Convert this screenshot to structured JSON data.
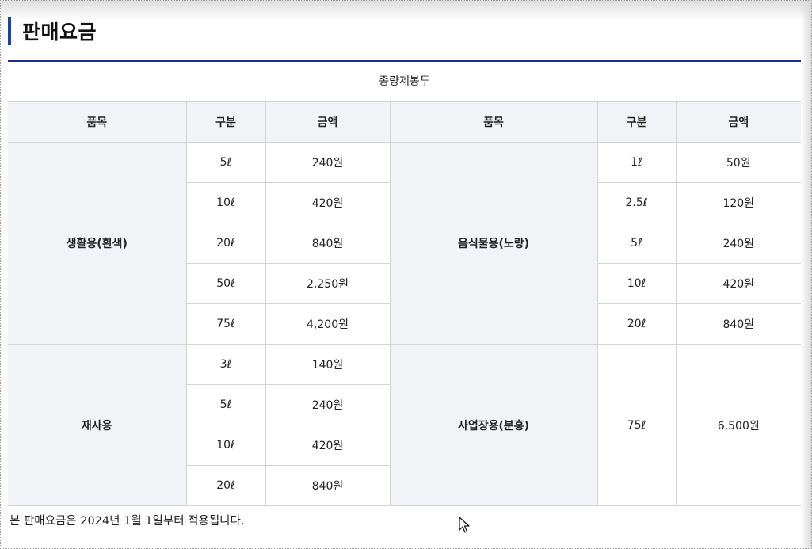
{
  "title": "판매요금",
  "table": {
    "caption": "종량제봉투",
    "headers": [
      "품목",
      "구분",
      "금액",
      "품목",
      "구분",
      "금액"
    ],
    "left": [
      {
        "item": "생활용(흰색)",
        "rows": [
          {
            "size": "5ℓ",
            "price": "240원"
          },
          {
            "size": "10ℓ",
            "price": "420원"
          },
          {
            "size": "20ℓ",
            "price": "840원"
          },
          {
            "size": "50ℓ",
            "price": "2,250원"
          },
          {
            "size": "75ℓ",
            "price": "4,200원"
          }
        ]
      },
      {
        "item": "재사용",
        "rows": [
          {
            "size": "3ℓ",
            "price": "140원"
          },
          {
            "size": "5ℓ",
            "price": "240원"
          },
          {
            "size": "10ℓ",
            "price": "420원"
          },
          {
            "size": "20ℓ",
            "price": "840원"
          }
        ]
      }
    ],
    "right": [
      {
        "item": "음식물용(노랑)",
        "rows": [
          {
            "size": "1ℓ",
            "price": "50원"
          },
          {
            "size": "2.5ℓ",
            "price": "120원"
          },
          {
            "size": "5ℓ",
            "price": "240원"
          },
          {
            "size": "10ℓ",
            "price": "420원"
          },
          {
            "size": "20ℓ",
            "price": "840원"
          }
        ]
      },
      {
        "item": "사업장용(분홍)",
        "rows": [
          {
            "size": "75ℓ",
            "price": "6,500원"
          }
        ]
      }
    ]
  },
  "note": "본 판매요금은 2024년 1월 1일부터 적용됩니다.",
  "colors": {
    "accent_bar": "#1c3fa8",
    "table_top_border": "#1b2f88",
    "header_bg": "#f1f3f6"
  },
  "icons": {
    "cursor": "mouse-pointer-icon"
  }
}
